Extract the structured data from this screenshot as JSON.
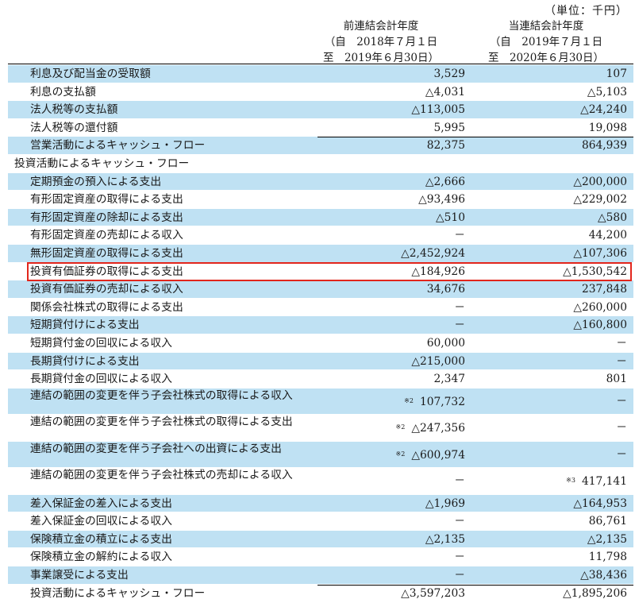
{
  "unit_label": "（単位：千円）",
  "columns": {
    "prev": {
      "title": "前連結会計年度",
      "from": "（自　2018年７月１日",
      "to": "至　2019年６月30日）"
    },
    "curr": {
      "title": "当連結会計年度",
      "from": "（自　2019年７月１日",
      "to": "至　2020年６月30日）"
    }
  },
  "rows": [
    {
      "label": "利息及び配当金の受取額",
      "prev": "3,529",
      "curr": "107",
      "shade": true
    },
    {
      "label": "利息の支払額",
      "prev": "△4,031",
      "curr": "△5,103",
      "shade": false
    },
    {
      "label": "法人税等の支払額",
      "prev": "△113,005",
      "curr": "△24,240",
      "shade": true
    },
    {
      "label": "法人税等の還付額",
      "prev": "5,995",
      "curr": "19,098",
      "shade": false
    },
    {
      "label": "営業活動によるキャッシュ・フロー",
      "prev": "82,375",
      "curr": "864,939",
      "shade": true,
      "total": true
    },
    {
      "label": "投資活動によるキャッシュ・フロー",
      "prev": "",
      "curr": "",
      "shade": false,
      "section": true
    },
    {
      "label": "定期預金の預入による支出",
      "prev": "△2,666",
      "curr": "△200,000",
      "shade": true
    },
    {
      "label": "有形固定資産の取得による支出",
      "prev": "△93,496",
      "curr": "△229,002",
      "shade": false
    },
    {
      "label": "有形固定資産の除却による支出",
      "prev": "△510",
      "curr": "△580",
      "shade": true
    },
    {
      "label": "有形固定資産の売却による収入",
      "prev": "－",
      "curr": "44,200",
      "shade": false
    },
    {
      "label": "無形固定資産の取得による支出",
      "prev": "△2,452,924",
      "curr": "△107,306",
      "shade": true
    },
    {
      "label": "投資有価証券の取得による支出",
      "prev": "△184,926",
      "curr": "△1,530,542",
      "shade": false,
      "highlight": true
    },
    {
      "label": "投資有価証券の売却による収入",
      "prev": "34,676",
      "curr": "237,848",
      "shade": true
    },
    {
      "label": "関係会社株式の取得による支出",
      "prev": "－",
      "curr": "△260,000",
      "shade": false
    },
    {
      "label": "短期貸付けによる支出",
      "prev": "－",
      "curr": "△160,800",
      "shade": true
    },
    {
      "label": "短期貸付金の回収による収入",
      "prev": "60,000",
      "curr": "－",
      "shade": false
    },
    {
      "label": "長期貸付けによる支出",
      "prev": "△215,000",
      "curr": "－",
      "shade": true
    },
    {
      "label": "長期貸付金の回収による収入",
      "prev": "2,347",
      "curr": "801",
      "shade": false
    },
    {
      "label": "連結の範囲の変更を伴う子会社株式の取得による収入",
      "prev": "107,732",
      "prev_note": "※2",
      "curr": "－",
      "shade": true,
      "tall": true
    },
    {
      "label": "連結の範囲の変更を伴う子会社株式の取得による支出",
      "prev": "△247,356",
      "prev_note": "※2",
      "curr": "－",
      "shade": false,
      "tall": true
    },
    {
      "label": "連結の範囲の変更を伴う子会社への出資による支出",
      "prev": "△600,974",
      "prev_note": "※2",
      "curr": "－",
      "shade": true,
      "tall": true
    },
    {
      "label": "連結の範囲の変更を伴う子会社株式の売却による収入",
      "prev": "－",
      "curr": "417,141",
      "curr_note": "※3",
      "shade": false,
      "tall": true
    },
    {
      "label": "差入保証金の差入による支出",
      "prev": "△1,969",
      "curr": "△164,953",
      "shade": true
    },
    {
      "label": "差入保証金の回収による収入",
      "prev": "－",
      "curr": "86,761",
      "shade": false
    },
    {
      "label": "保険積立金の積立による支出",
      "prev": "△2,135",
      "curr": "△2,135",
      "shade": true
    },
    {
      "label": "保険積立金の解約による収入",
      "prev": "－",
      "curr": "11,798",
      "shade": false
    },
    {
      "label": "事業譲受による支出",
      "prev": "－",
      "curr": "△38,436",
      "shade": true
    },
    {
      "label": "投資活動によるキャッシュ・フロー",
      "prev": "△3,597,203",
      "curr": "△1,895,206",
      "shade": false,
      "total": true
    }
  ],
  "colors": {
    "row_shade": "#bfe1f3",
    "highlight_border": "#e2261c"
  }
}
